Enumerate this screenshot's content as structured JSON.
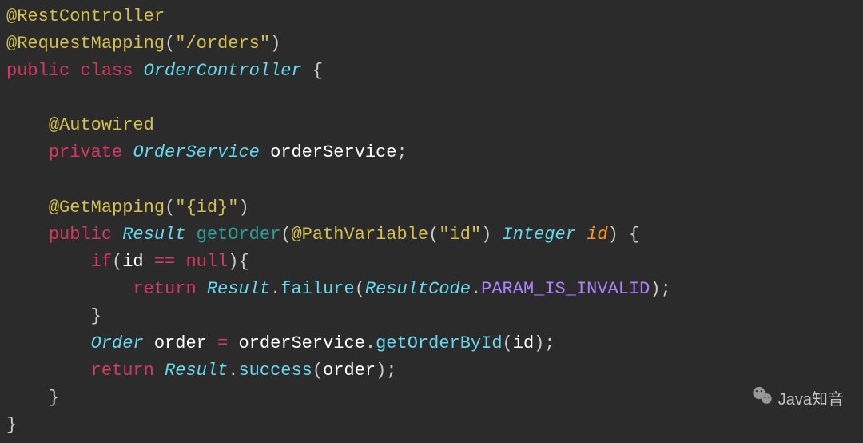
{
  "code": {
    "line1": {
      "annotation": "@RestController"
    },
    "line2": {
      "annotation": "@RequestMapping",
      "lparen": "(",
      "str": "\"/orders\"",
      "rparen": ")"
    },
    "line3": {
      "kw_public": "public",
      "sp1": " ",
      "kw_class": "class",
      "sp2": " ",
      "type": "OrderController",
      "sp3": " ",
      "brace": "{"
    },
    "blank1": "",
    "line5": {
      "indent": "    ",
      "annotation": "@Autowired"
    },
    "line6": {
      "indent": "    ",
      "kw_private": "private",
      "sp1": " ",
      "type": "OrderService",
      "sp2": " ",
      "name": "orderService",
      "semi": ";"
    },
    "blank2": "",
    "line8": {
      "indent": "    ",
      "annotation": "@GetMapping",
      "lparen": "(",
      "str": "\"{id}\"",
      "rparen": ")"
    },
    "line9": {
      "indent": "    ",
      "kw_public": "public",
      "sp1": " ",
      "type_result": "Result",
      "sp2": " ",
      "method": "getOrder",
      "lparen": "(",
      "annotation": "@PathVariable",
      "lparen2": "(",
      "str": "\"id\"",
      "rparen2": ")",
      "sp3": " ",
      "type_int": "Integer",
      "sp4": " ",
      "param": "id",
      "rparen": ")",
      "sp5": " ",
      "brace": "{"
    },
    "line10": {
      "indent": "        ",
      "kw_if": "if",
      "lparen": "(",
      "var": "id ",
      "op": "==",
      "sp": " ",
      "null": "null",
      "rparen": ")",
      "brace": "{"
    },
    "line11": {
      "indent": "            ",
      "kw_return": "return",
      "sp1": " ",
      "type": "Result",
      "dot1": ".",
      "method": "failure",
      "lparen": "(",
      "type2": "ResultCode",
      "dot2": ".",
      "constant": "PARAM_IS_INVALID",
      "rparen": ")",
      "semi": ";"
    },
    "line12": {
      "indent": "        ",
      "brace": "}"
    },
    "line13": {
      "indent": "        ",
      "type": "Order",
      "sp1": " ",
      "var": "order",
      "sp2": " ",
      "eq": "=",
      "sp3": " ",
      "obj": "orderService",
      "dot": ".",
      "method": "getOrderById",
      "lparen": "(",
      "arg": "id",
      "rparen": ")",
      "semi": ";"
    },
    "line14": {
      "indent": "        ",
      "kw_return": "return",
      "sp1": " ",
      "type": "Result",
      "dot": ".",
      "method": "success",
      "lparen": "(",
      "arg": "order",
      "rparen": ")",
      "semi": ";"
    },
    "line15": {
      "indent": "    ",
      "brace": "}"
    },
    "line16": {
      "brace": "}"
    }
  },
  "watermark": {
    "text": "Java知音"
  }
}
